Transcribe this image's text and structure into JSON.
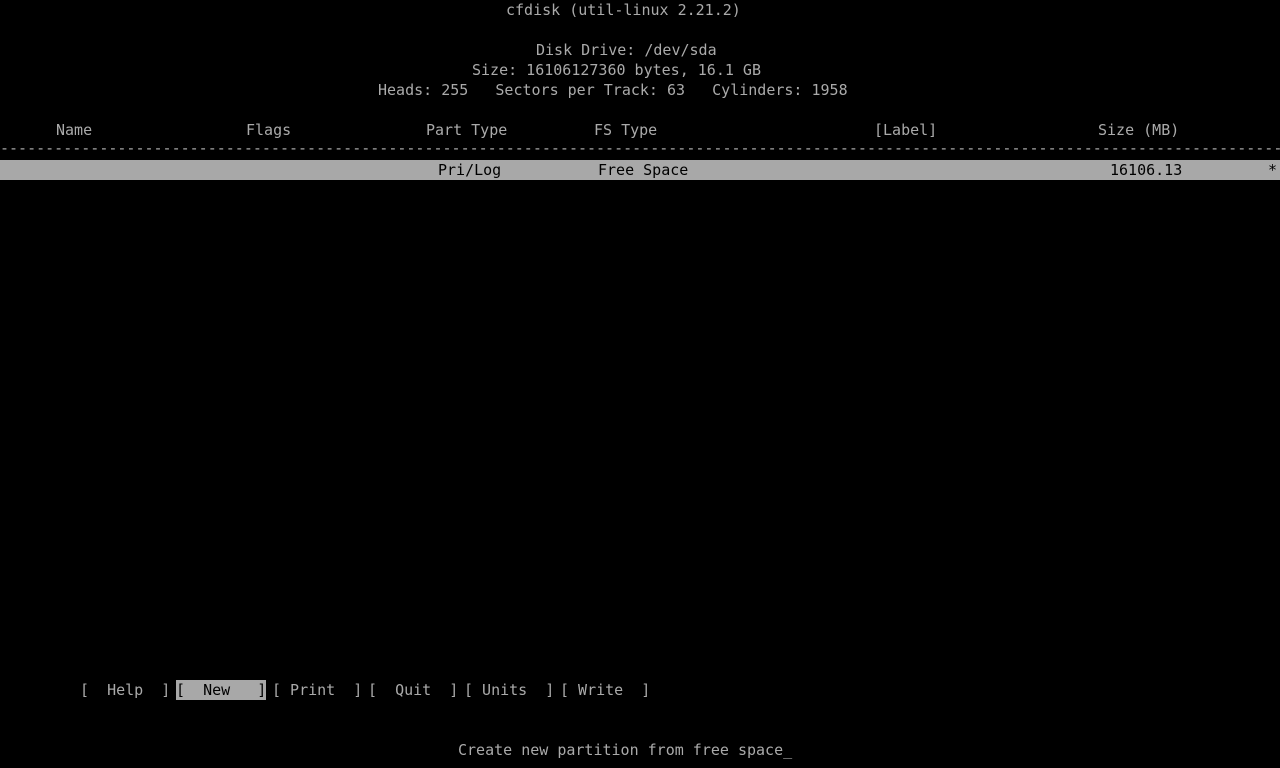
{
  "app": {
    "title": "cfdisk (util-linux 2.21.2)"
  },
  "disk": {
    "drive_line": "Disk Drive: /dev/sda",
    "size_line": "Size: 16106127360 bytes, 16.1 GB",
    "geometry_line": "Heads: 255   Sectors per Track: 63   Cylinders: 1958",
    "heads": "255",
    "sectors_per_track": "63",
    "cylinders": "1958",
    "size_bytes": "16106127360",
    "size_human": "16.1 GB",
    "device": "/dev/sda"
  },
  "table": {
    "headers": {
      "name": "Name",
      "flags": "Flags",
      "part_type": "Part Type",
      "fs_type": "FS Type",
      "label": "[Label]",
      "size": "Size (MB)"
    },
    "separator_char": "-",
    "rows": [
      {
        "name": "",
        "flags": "",
        "part_type": "Pri/Log",
        "fs_type": "Free Space",
        "label": "",
        "size": "16106.13",
        "marker": "*",
        "selected": true
      }
    ]
  },
  "menu": {
    "buttons": [
      {
        "label": "Help",
        "selected": false
      },
      {
        "label": "New",
        "selected": true
      },
      {
        "label": "Print",
        "selected": false
      },
      {
        "label": "Quit",
        "selected": false
      },
      {
        "label": "Units",
        "selected": false
      },
      {
        "label": "Write",
        "selected": false
      }
    ],
    "bracket_open": "[",
    "bracket_close": "]"
  },
  "status": {
    "message": "Create new partition from free space",
    "cursor": "_"
  },
  "colors": {
    "background": "#000000",
    "foreground": "#aaaaaa",
    "highlight_bg": "#a8a8a8",
    "highlight_fg": "#000000"
  }
}
